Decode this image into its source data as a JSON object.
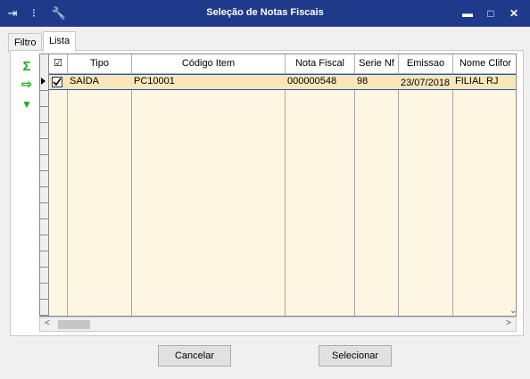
{
  "window": {
    "title": "Seleção de Notas Fiscais",
    "controls": {
      "minimize": "▬",
      "maximize": "□",
      "close": "✕"
    },
    "toolbar_icons": [
      "export-icon",
      "traffic-light-icon",
      "wrench-icon"
    ]
  },
  "tabs": [
    {
      "label": "Filtro",
      "active": false
    },
    {
      "label": "Lista",
      "active": true
    }
  ],
  "side_tools": [
    {
      "icon": "sum-icon",
      "glyph": "Σ"
    },
    {
      "icon": "export-icon",
      "glyph": "⇨"
    },
    {
      "icon": "collapse-down-icon",
      "glyph": "▼"
    }
  ],
  "table": {
    "columns": [
      "☑",
      "Tipo",
      "Código Item",
      "Nota Fiscal",
      "Serie Nf",
      "Emissao",
      "Nome Clifor"
    ],
    "rows": [
      {
        "checked": true,
        "tipo": "SAÍDA",
        "codigo_item": "PC10001",
        "nota_fiscal": "000000548",
        "serie_nf": "98",
        "emissao": "23/07/2018",
        "nome_clifor": "FILIAL RJ"
      }
    ]
  },
  "buttons": {
    "cancel": "Cancelar",
    "select": "Selecionar"
  },
  "colors": {
    "title_bar": "#1f3a8a",
    "row_highlight": "#fbe6b8",
    "grid_background": "#fdf6e3",
    "accent_green": "#18b018"
  }
}
